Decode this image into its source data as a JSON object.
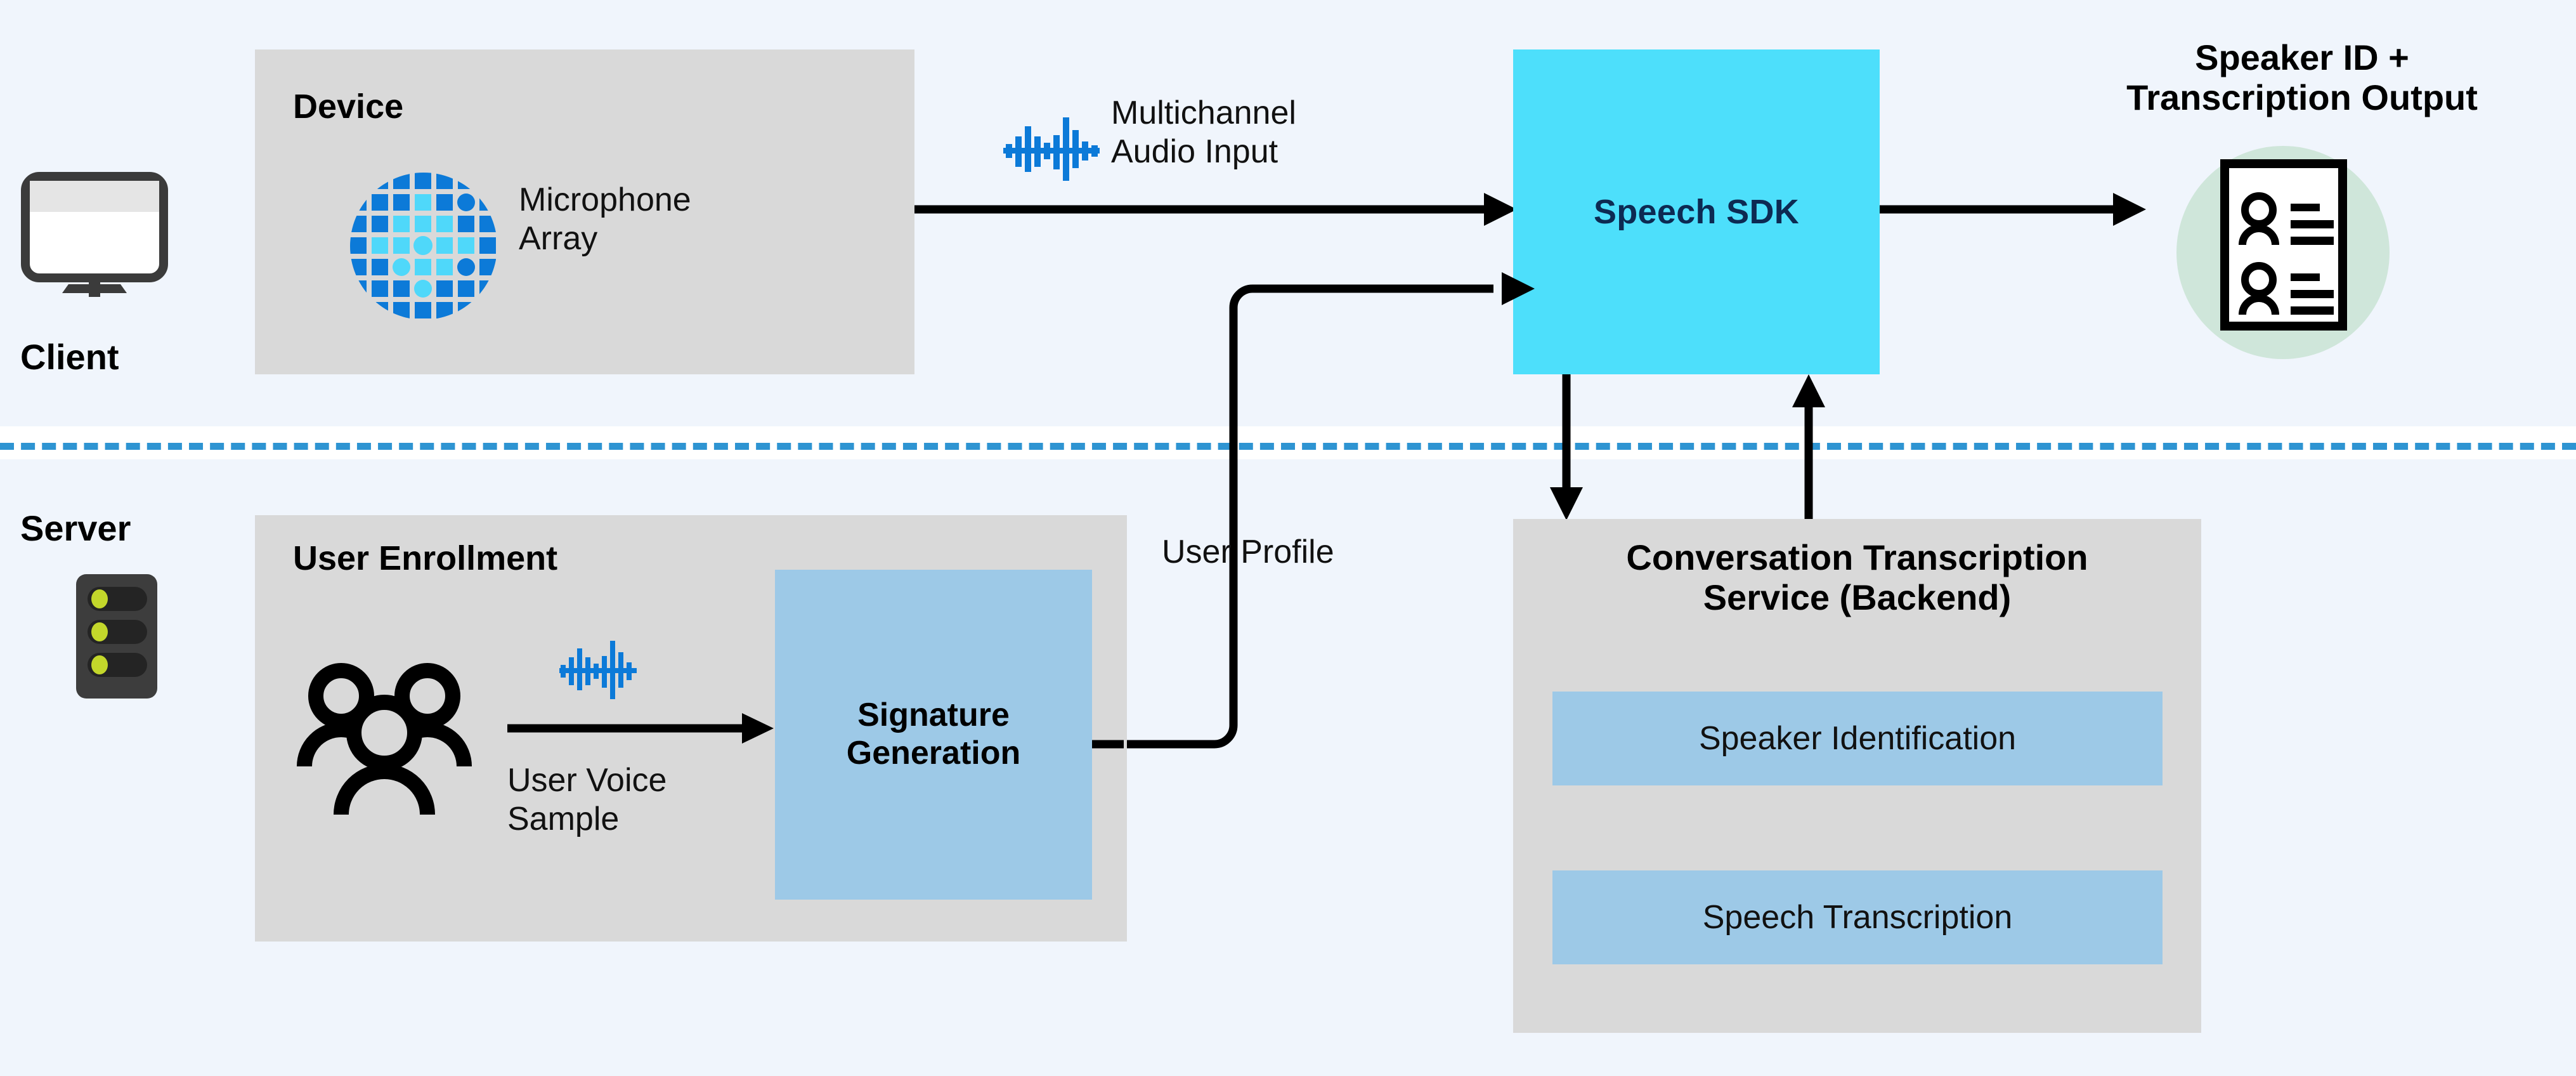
{
  "diagram": {
    "title": "Conversation Transcription architecture",
    "background_color": "#f0f5fc",
    "panel_color": "#d9d9d9",
    "accent_cyan": "#4ddffb",
    "accent_blue": "#9dc9e7",
    "divider_color": "#2e94d2",
    "green_circle_color": "#cfe6da"
  },
  "zones": {
    "client_label": "Client",
    "server_label": "Server"
  },
  "device": {
    "title": "Device",
    "mic_label": "Microphone\nArray",
    "icon": "microphone-array-icon"
  },
  "flows": {
    "multichannel_audio": "Multichannel\nAudio Input",
    "user_profile": "User Profile",
    "user_voice_sample": "User Voice\nSample",
    "audio_waveform_icon": "audio-waveform-icon"
  },
  "sdk": {
    "label": "Speech SDK"
  },
  "output": {
    "title": "Speaker ID +\nTranscription Output",
    "icon": "transcript-document-icon"
  },
  "enrollment": {
    "title": "User Enrollment",
    "people_icon": "people-group-icon",
    "signature_box": "Signature\nGeneration"
  },
  "backend": {
    "title": "Conversation Transcription\nService (Backend)",
    "modules": [
      {
        "label": "Speaker Identification"
      },
      {
        "label": "Speech Transcription"
      }
    ]
  },
  "icons": {
    "client_monitor": "monitor-icon",
    "server_rack": "server-rack-icon"
  }
}
